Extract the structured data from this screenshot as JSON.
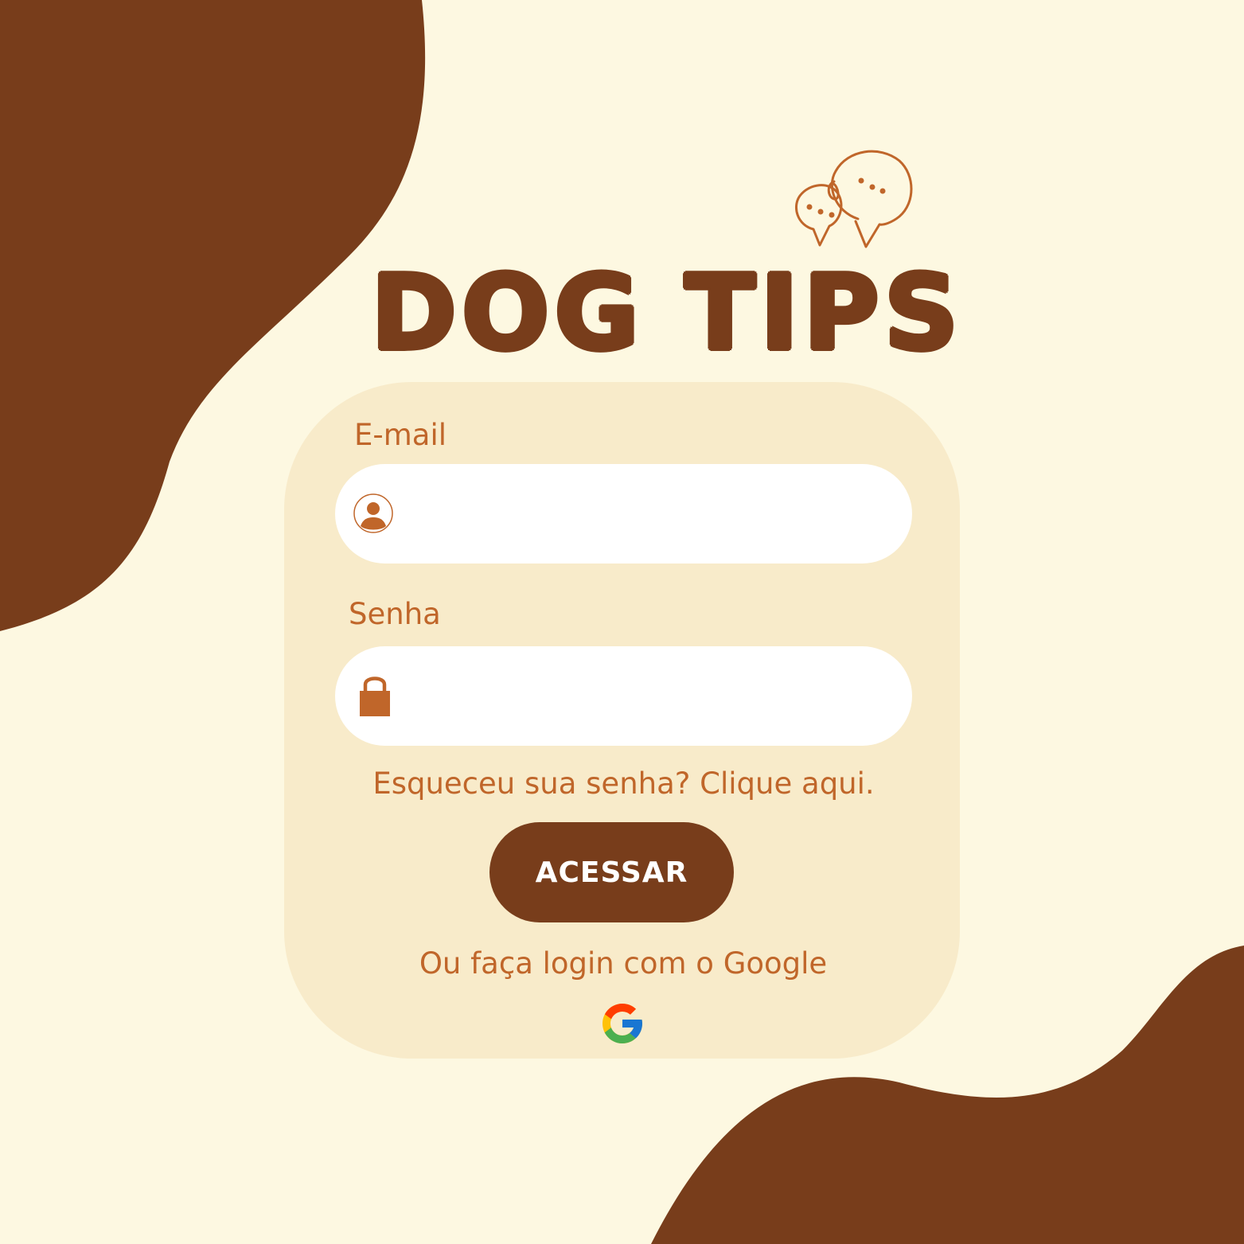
{
  "app": {
    "title": "DOG TIPS"
  },
  "form": {
    "email_label": "E-mail",
    "email_value": "",
    "password_label": "Senha",
    "password_value": "",
    "forgot_link": "Esqueceu sua senha? Clique aqui.",
    "submit_label": "ACESSAR",
    "google_text": "Ou faça login com o Google"
  },
  "icons": {
    "email": "user-icon",
    "password": "lock-icon",
    "google": "google-icon",
    "decoration": "chat-bubbles-icon"
  },
  "colors": {
    "background": "#FDF8E1",
    "brown": "#783D1B",
    "card": "#F8EBCA",
    "accent": "#C0662A",
    "input": "#FFFFFF"
  }
}
